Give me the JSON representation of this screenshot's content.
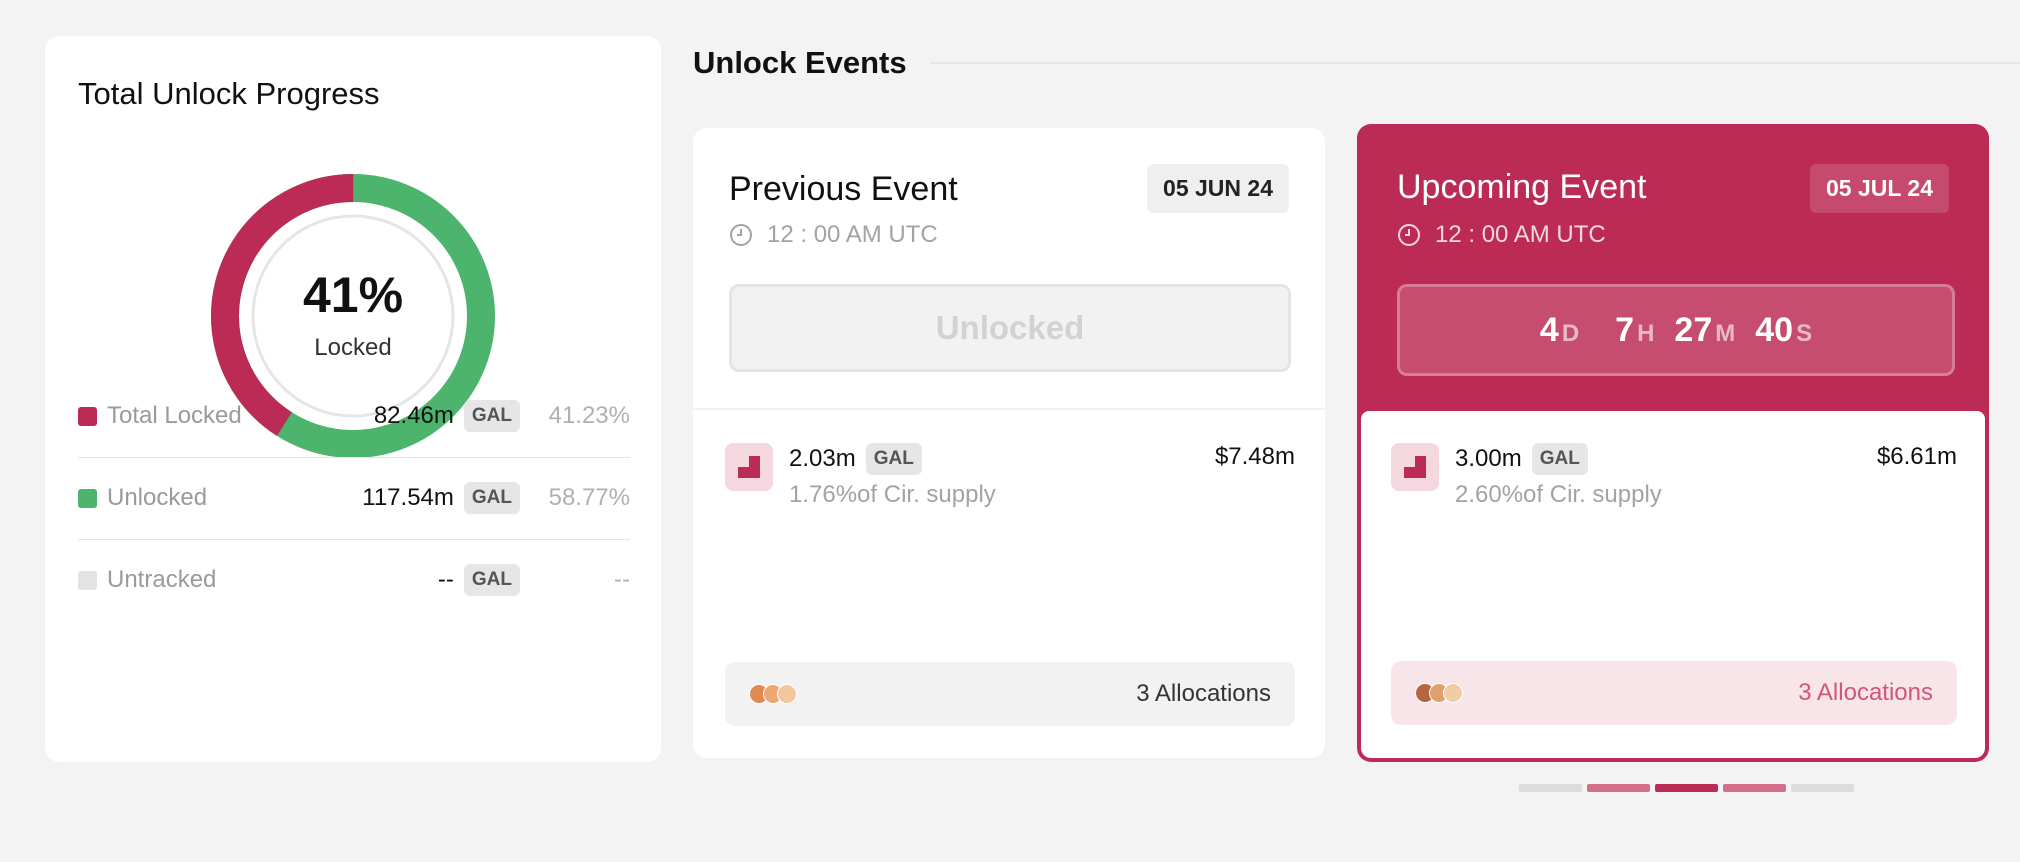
{
  "progress": {
    "title": "Total Unlock Progress",
    "locked_percent": 41,
    "donut_label": "41%",
    "donut_caption": "Locked",
    "legend": [
      {
        "label": "Total Locked",
        "amount": "82.46m",
        "token": "GAL",
        "percent": "41.23%",
        "color": "#bb2b55"
      },
      {
        "label": "Unlocked",
        "amount": "117.54m",
        "token": "GAL",
        "percent": "58.77%",
        "color": "#4cb46d"
      },
      {
        "label": "Untracked",
        "amount": "--",
        "token": "GAL",
        "percent": "--",
        "color": "#e3e3e3"
      }
    ]
  },
  "events": {
    "title": "Unlock Events",
    "previous": {
      "title": "Previous Event",
      "date": "05 JUN 24",
      "time": "12 : 00 AM UTC",
      "status": "Unlocked",
      "amount": "2.03m",
      "token": "GAL",
      "supply": "1.76%of Cir. supply",
      "usd": "$7.48m",
      "allocations": "3 Allocations"
    },
    "upcoming": {
      "title": "Upcoming Event",
      "date": "05 JUL 24",
      "time": "12 : 00 AM UTC",
      "countdown": {
        "days": "4",
        "days_suffix": "D",
        "hours": "7",
        "hours_suffix": "H",
        "minutes": "27",
        "minutes_suffix": "M",
        "seconds": "40",
        "seconds_suffix": "S"
      },
      "amount": "3.00m",
      "token": "GAL",
      "supply": "2.60%of Cir. supply",
      "usd": "$6.61m",
      "allocations": "3 Allocations"
    },
    "pager": {
      "count": 5,
      "active_index": 2
    }
  },
  "colors": {
    "accent": "#bb2b55",
    "locked": "#bb2b55",
    "unlocked": "#4cb46d",
    "untracked": "#e3e3e3"
  },
  "icons": [
    "clock-icon",
    "token-logo-icon",
    "allocation-dots-icon"
  ]
}
